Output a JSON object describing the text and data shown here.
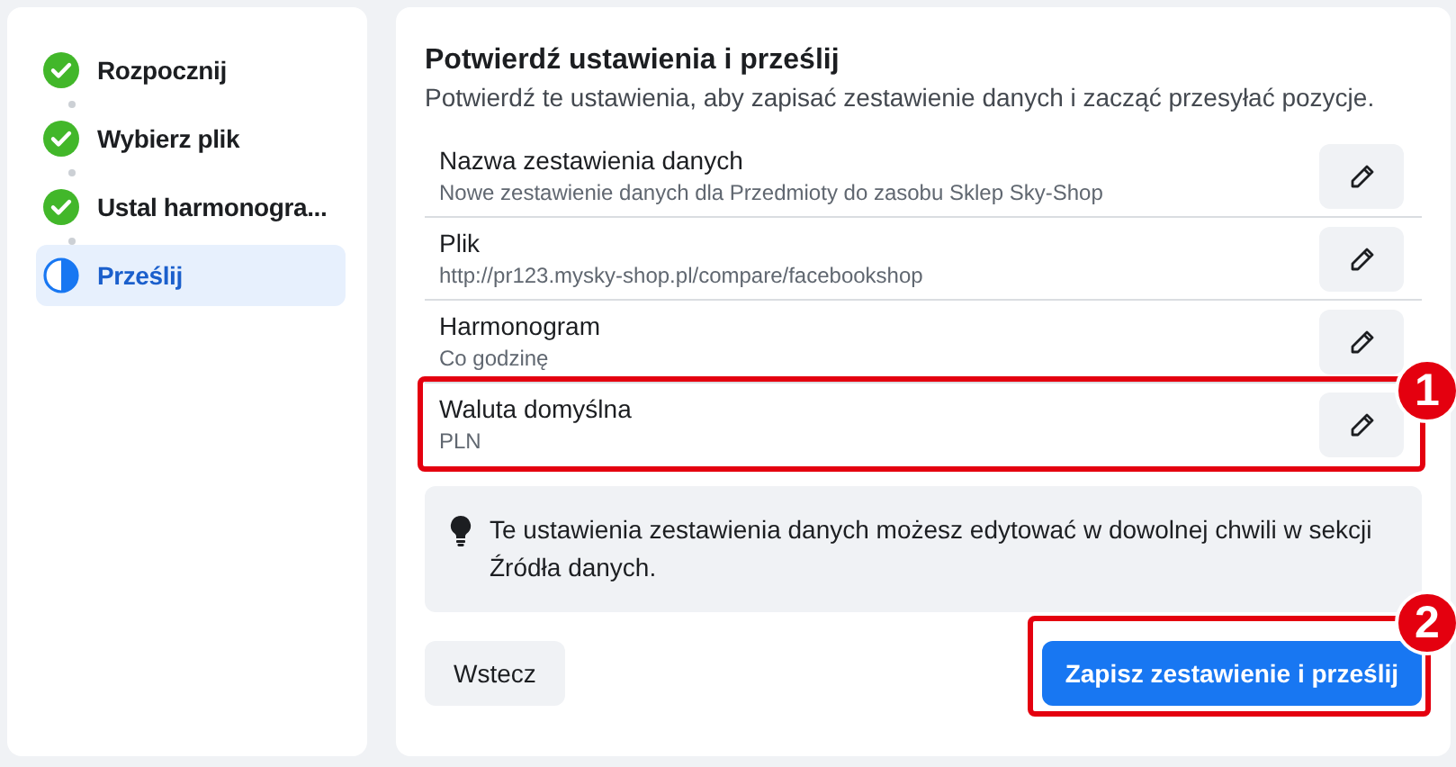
{
  "steps": [
    {
      "label": "Rozpocznij",
      "kind": "done",
      "selected": false
    },
    {
      "label": "Wybierz plik",
      "kind": "done",
      "selected": false
    },
    {
      "label": "Ustal harmonogra...",
      "kind": "done",
      "selected": false
    },
    {
      "label": "Prześlij",
      "kind": "current",
      "selected": true
    }
  ],
  "panel": {
    "title": "Potwierdź ustawienia i prześlij",
    "subtitle": "Potwierdź te ustawienia, aby zapisać zestawienie danych i zacząć przesyłać pozycje.",
    "settings": [
      {
        "label": "Nazwa zestawienia danych",
        "value": "Nowe zestawienie danych dla Przedmioty do zasobu Sklep Sky-Shop"
      },
      {
        "label": "Plik",
        "value": "http://pr123.mysky-shop.pl/compare/facebookshop"
      },
      {
        "label": "Harmonogram",
        "value": "Co godzinę"
      },
      {
        "label": "Waluta domyślna",
        "value": "PLN",
        "callout": "1"
      }
    ],
    "info": "Te ustawienia zestawienia danych możesz edytować w dowolnej chwili w sekcji Źródła danych.",
    "back_button": "Wstecz",
    "submit_button": {
      "label": "Zapisz zestawienie i prześlij",
      "callout": "2"
    }
  }
}
